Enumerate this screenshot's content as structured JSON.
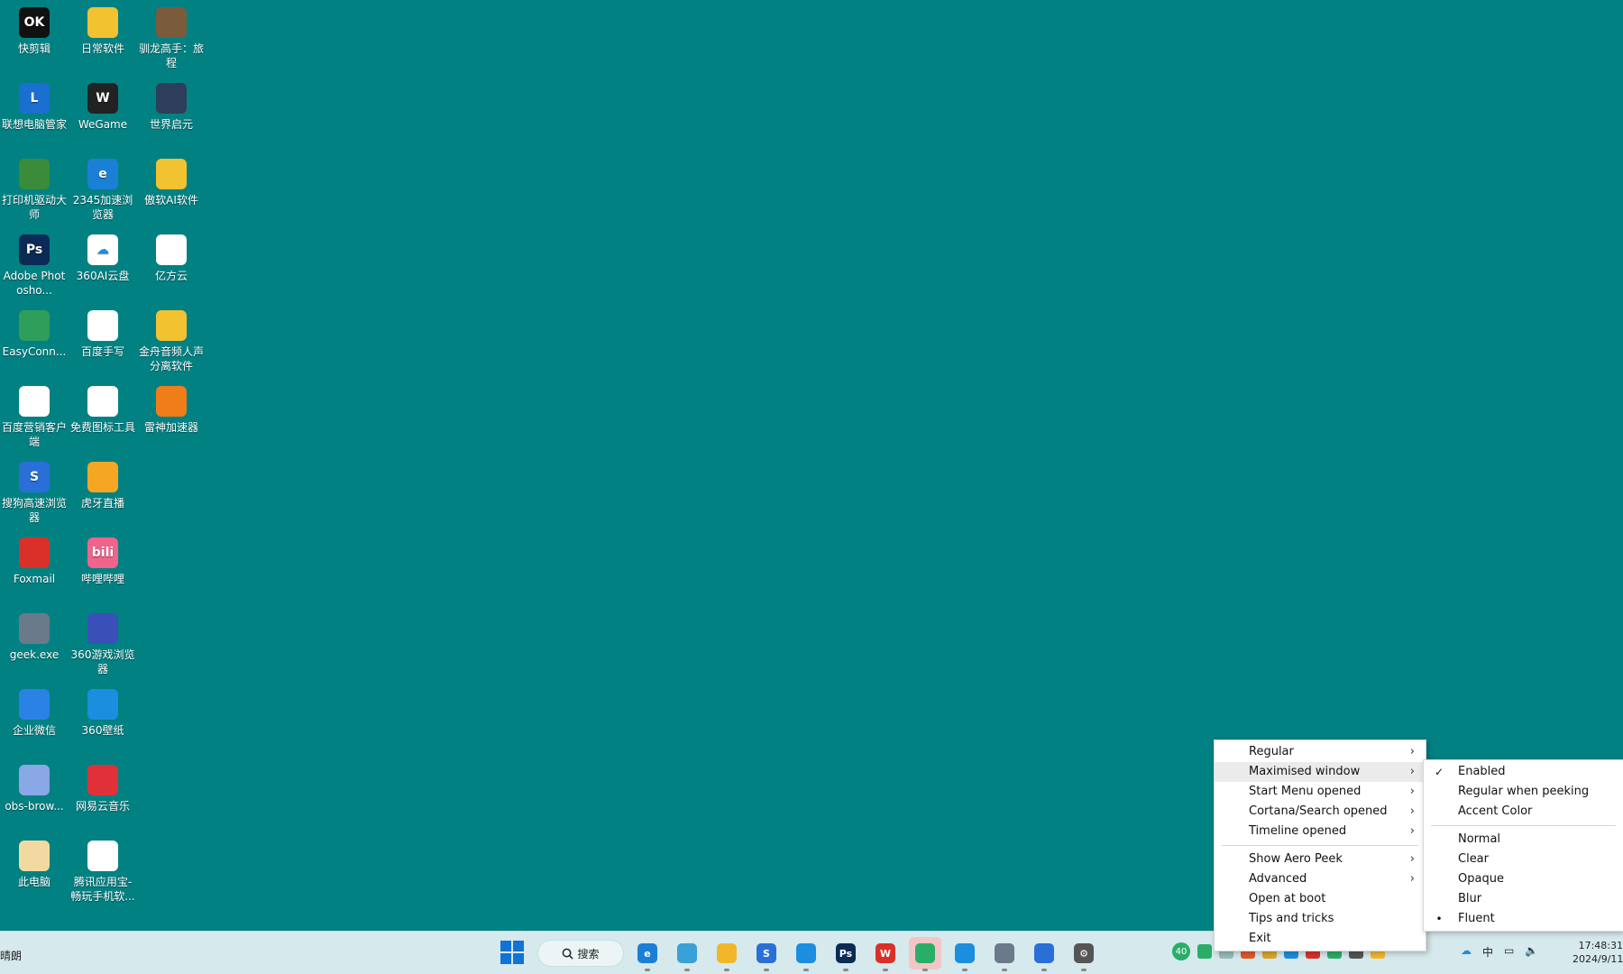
{
  "desktop": {
    "icons": [
      {
        "label": "快剪辑",
        "color": "#111111",
        "glyph": "OK",
        "icon": "kuaijianji-icon"
      },
      {
        "label": "日常软件",
        "color": "#f2c230",
        "glyph": "",
        "icon": "folder-icon"
      },
      {
        "label": "驯龙高手：旅程",
        "color": "#7a5b3c",
        "glyph": "",
        "icon": "game-icon"
      },
      {
        "label": "联想电脑管家",
        "color": "#1b6fd1",
        "glyph": "L",
        "icon": "lenovo-icon"
      },
      {
        "label": "WeGame",
        "color": "#222222",
        "glyph": "W",
        "icon": "wegame-icon"
      },
      {
        "label": "世界启元",
        "color": "#2e3d5a",
        "glyph": "",
        "icon": "game-icon"
      },
      {
        "label": "打印机驱动大师",
        "color": "#3a8b3a",
        "glyph": "",
        "icon": "printer-icon"
      },
      {
        "label": "2345加速浏览器",
        "color": "#1c7fd6",
        "glyph": "e",
        "icon": "browser-icon"
      },
      {
        "label": "傲软AI软件",
        "color": "#f2c230",
        "glyph": "",
        "icon": "folder-icon"
      },
      {
        "label": "Adobe Photosho...",
        "color": "#0b2a56",
        "glyph": "Ps",
        "icon": "photoshop-icon"
      },
      {
        "label": "360AI云盘",
        "color": "#ffffff",
        "glyph": "☁",
        "icon": "cloud-drive-icon"
      },
      {
        "label": "亿方云",
        "color": "#ffffff",
        "glyph": "",
        "icon": "yifangyun-icon"
      },
      {
        "label": "EasyConn...",
        "color": "#2f9e5b",
        "glyph": "",
        "icon": "easyconnect-icon"
      },
      {
        "label": "百度手写",
        "color": "#ffffff",
        "glyph": "",
        "icon": "handwriting-icon"
      },
      {
        "label": "金舟音频人声分离软件",
        "color": "#f2c230",
        "glyph": "",
        "icon": "folder-icon"
      },
      {
        "label": "百度营销客户端",
        "color": "#ffffff",
        "glyph": "",
        "icon": "baidu-marketing-icon"
      },
      {
        "label": "免费图标工具",
        "color": "#ffffff",
        "glyph": "",
        "icon": "icon-tool-icon"
      },
      {
        "label": "雷神加速器",
        "color": "#f07c1a",
        "glyph": "",
        "icon": "accelerator-icon"
      },
      {
        "label": "搜狗高速浏览器",
        "color": "#2a6fd8",
        "glyph": "S",
        "icon": "sogou-browser-icon"
      },
      {
        "label": "虎牙直播",
        "color": "#f5a623",
        "glyph": "",
        "icon": "huya-icon"
      },
      {
        "label": "",
        "color": "",
        "glyph": "",
        "icon": "empty"
      },
      {
        "label": "Foxmail",
        "color": "#d9312a",
        "glyph": "",
        "icon": "foxmail-icon"
      },
      {
        "label": "哔哩哔哩",
        "color": "#f0648c",
        "glyph": "bili",
        "icon": "bilibili-icon"
      },
      {
        "label": "",
        "color": "",
        "glyph": "",
        "icon": "empty"
      },
      {
        "label": "geek.exe",
        "color": "#6b7a8a",
        "glyph": "",
        "icon": "geek-icon"
      },
      {
        "label": "360游戏浏览器",
        "color": "#3a4fb8",
        "glyph": "",
        "icon": "game-browser-icon"
      },
      {
        "label": "",
        "color": "",
        "glyph": "",
        "icon": "empty"
      },
      {
        "label": "企业微信",
        "color": "#2a82e4",
        "glyph": "",
        "icon": "wecom-icon"
      },
      {
        "label": "360壁纸",
        "color": "#1b8ee0",
        "glyph": "",
        "icon": "wallpaper-icon"
      },
      {
        "label": "",
        "color": "",
        "glyph": "",
        "icon": "empty"
      },
      {
        "label": "obs-brow...",
        "color": "#8aa7e6",
        "glyph": "",
        "icon": "obs-icon"
      },
      {
        "label": "网易云音乐",
        "color": "#e0303a",
        "glyph": "",
        "icon": "netease-music-icon"
      },
      {
        "label": "",
        "color": "",
        "glyph": "",
        "icon": "empty"
      },
      {
        "label": "此电脑",
        "color": "#f2d9a0",
        "glyph": "",
        "icon": "this-pc-icon"
      },
      {
        "label": "腾讯应用宝-畅玩手机软...",
        "color": "#ffffff",
        "glyph": "",
        "icon": "yingyongbao-icon"
      }
    ]
  },
  "taskbar": {
    "weather": "晴朗",
    "search_label": "搜索",
    "apps": [
      {
        "icon": "edge-icon",
        "color": "#1b7fd6",
        "glyph": "e",
        "active": false
      },
      {
        "icon": "notepad-icon",
        "color": "#3aa0d8",
        "glyph": "",
        "active": false
      },
      {
        "icon": "file-explorer-icon",
        "color": "#f2b62b",
        "glyph": "",
        "active": false
      },
      {
        "icon": "sogou-icon",
        "color": "#2a6fd8",
        "glyph": "S",
        "active": false
      },
      {
        "icon": "app-store-icon",
        "color": "#1b8ee0",
        "glyph": "",
        "active": false
      },
      {
        "icon": "photoshop-icon",
        "color": "#0b2a56",
        "glyph": "Ps",
        "active": false
      },
      {
        "icon": "wps-icon",
        "color": "#d9312a",
        "glyph": "W",
        "active": false
      },
      {
        "icon": "wechat-icon",
        "color": "#2aae67",
        "glyph": "",
        "active": true
      },
      {
        "icon": "qq-browser-icon",
        "color": "#1b8ee0",
        "glyph": "",
        "active": false
      },
      {
        "icon": "geek-icon",
        "color": "#6b7a8a",
        "glyph": "",
        "active": false
      },
      {
        "icon": "sogou-input-icon",
        "color": "#2a6fd8",
        "glyph": "",
        "active": false
      },
      {
        "icon": "settings-icon",
        "color": "#555555",
        "glyph": "⚙",
        "active": false
      }
    ],
    "tray_badge": "40",
    "tray_icons": [
      "#2aae67",
      "#9bb",
      "#e05a2a",
      "#d9a62a",
      "#1b8ee0",
      "#d9312a",
      "#2aae67",
      "#555",
      "#f2b62b"
    ],
    "ime_label": "中",
    "clock_time": "17:48:31",
    "clock_date": "2024/9/11"
  },
  "menu": {
    "items": [
      {
        "label": "Regular",
        "arrow": true,
        "highlight": false
      },
      {
        "label": "Maximised window",
        "arrow": true,
        "highlight": true
      },
      {
        "label": "Start Menu opened",
        "arrow": true,
        "highlight": false
      },
      {
        "label": "Cortana/Search opened",
        "arrow": true,
        "highlight": false
      },
      {
        "label": "Timeline opened",
        "arrow": true,
        "highlight": false
      },
      {
        "sep": true
      },
      {
        "label": "Show Aero Peek",
        "arrow": true,
        "highlight": false
      },
      {
        "label": "Advanced",
        "arrow": true,
        "highlight": false
      },
      {
        "label": "Open at boot",
        "arrow": false,
        "highlight": false
      },
      {
        "label": "Tips and tricks",
        "arrow": false,
        "highlight": false
      },
      {
        "label": "Exit",
        "arrow": false,
        "highlight": false
      }
    ],
    "arrow_glyph": "›"
  },
  "submenu": {
    "items": [
      {
        "label": "Enabled",
        "mark": "✓"
      },
      {
        "label": "Regular when peeking",
        "mark": ""
      },
      {
        "label": "Accent Color",
        "mark": ""
      },
      {
        "sep": true
      },
      {
        "label": "Normal",
        "mark": ""
      },
      {
        "label": "Clear",
        "mark": ""
      },
      {
        "label": "Opaque",
        "mark": ""
      },
      {
        "label": "Blur",
        "mark": ""
      },
      {
        "label": "Fluent",
        "mark": "•"
      }
    ]
  }
}
